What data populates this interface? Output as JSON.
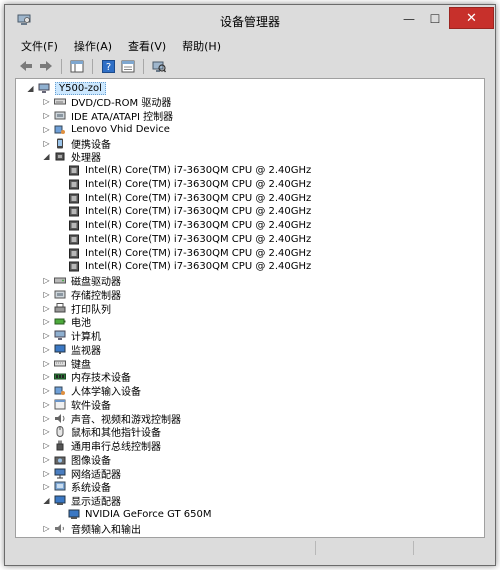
{
  "window": {
    "title": "设备管理器"
  },
  "controls": {
    "minimize": "—",
    "maximize": "☐",
    "close": "✕"
  },
  "menu": [
    "文件(F)",
    "操作(A)",
    "查看(V)",
    "帮助(H)"
  ],
  "tree": {
    "root": "Y500-zol",
    "categories": [
      {
        "label": "DVD/CD-ROM 驱动器",
        "icon": "optical-drive-icon",
        "expanded": false
      },
      {
        "label": "IDE ATA/ATAPI 控制器",
        "icon": "ide-controller-icon",
        "expanded": false
      },
      {
        "label": "Lenovo Vhid Device",
        "icon": "hid-device-icon",
        "expanded": false
      },
      {
        "label": "便携设备",
        "icon": "portable-device-icon",
        "expanded": false
      },
      {
        "label": "处理器",
        "icon": "processor-icon",
        "expanded": true,
        "children": [
          "Intel(R) Core(TM) i7-3630QM CPU @ 2.40GHz",
          "Intel(R) Core(TM) i7-3630QM CPU @ 2.40GHz",
          "Intel(R) Core(TM) i7-3630QM CPU @ 2.40GHz",
          "Intel(R) Core(TM) i7-3630QM CPU @ 2.40GHz",
          "Intel(R) Core(TM) i7-3630QM CPU @ 2.40GHz",
          "Intel(R) Core(TM) i7-3630QM CPU @ 2.40GHz",
          "Intel(R) Core(TM) i7-3630QM CPU @ 2.40GHz",
          "Intel(R) Core(TM) i7-3630QM CPU @ 2.40GHz"
        ]
      },
      {
        "label": "磁盘驱动器",
        "icon": "disk-drive-icon",
        "expanded": false
      },
      {
        "label": "存储控制器",
        "icon": "storage-controller-icon",
        "expanded": false
      },
      {
        "label": "打印队列",
        "icon": "printer-icon",
        "expanded": false
      },
      {
        "label": "电池",
        "icon": "battery-icon",
        "expanded": false
      },
      {
        "label": "计算机",
        "icon": "computer-icon",
        "expanded": false
      },
      {
        "label": "监视器",
        "icon": "monitor-icon",
        "expanded": false
      },
      {
        "label": "键盘",
        "icon": "keyboard-icon",
        "expanded": false
      },
      {
        "label": "内存技术设备",
        "icon": "memory-device-icon",
        "expanded": false
      },
      {
        "label": "人体学输入设备",
        "icon": "hid-input-icon",
        "expanded": false
      },
      {
        "label": "软件设备",
        "icon": "software-device-icon",
        "expanded": false
      },
      {
        "label": "声音、视频和游戏控制器",
        "icon": "sound-icon",
        "expanded": false
      },
      {
        "label": "鼠标和其他指针设备",
        "icon": "mouse-icon",
        "expanded": false
      },
      {
        "label": "通用串行总线控制器",
        "icon": "usb-icon",
        "expanded": false
      },
      {
        "label": "图像设备",
        "icon": "camera-icon",
        "expanded": false
      },
      {
        "label": "网络适配器",
        "icon": "network-adapter-icon",
        "expanded": false
      },
      {
        "label": "系统设备",
        "icon": "system-device-icon",
        "expanded": false
      },
      {
        "label": "显示适配器",
        "icon": "display-adapter-icon",
        "expanded": true,
        "children": [
          "NVIDIA GeForce GT 650M"
        ]
      },
      {
        "label": "音频输入和输出",
        "icon": "audio-io-icon",
        "expanded": false
      }
    ]
  }
}
